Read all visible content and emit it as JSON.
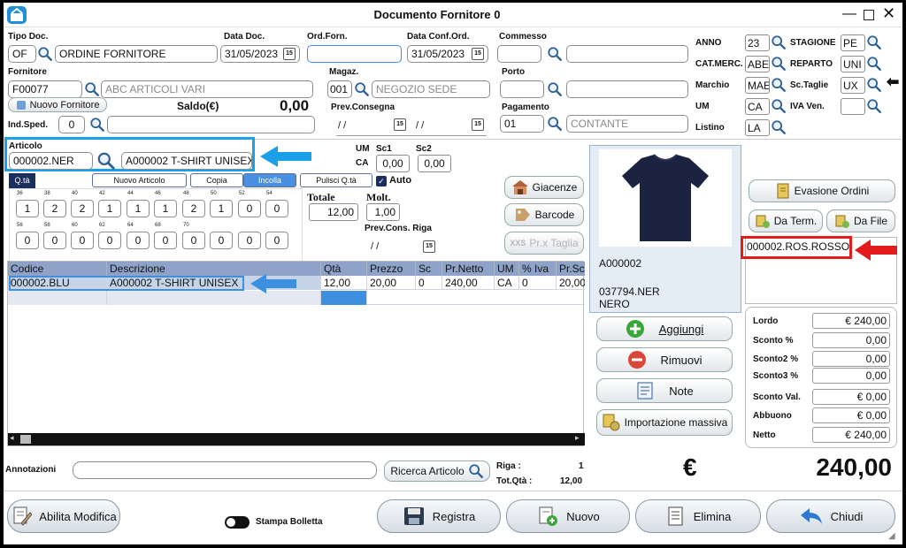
{
  "window": {
    "title": "Documento Fornitore 0"
  },
  "header": {
    "tipo_doc": {
      "label": "Tipo Doc.",
      "code": "OF",
      "desc": "ORDINE FORNITORE"
    },
    "data_doc": {
      "label": "Data Doc.",
      "value": "31/05/2023"
    },
    "ord_forn": {
      "label": "Ord.Forn.",
      "value": ""
    },
    "data_conf": {
      "label": "Data Conf.Ord.",
      "value": "31/05/2023"
    },
    "commesso": {
      "label": "Commesso",
      "code": "",
      "desc": ""
    },
    "fornitore": {
      "label": "Fornitore",
      "code": "F00077",
      "desc": "ABC ARTICOLI VARI"
    },
    "magaz": {
      "label": "Magaz.",
      "code": "001",
      "desc": "NEGOZIO SEDE"
    },
    "porto": {
      "label": "Porto",
      "code": "",
      "desc": ""
    },
    "nuovo_fornitore": "Nuovo Fornitore",
    "saldo": {
      "label": "Saldo(€)",
      "value": "0,00"
    },
    "prev_consegna": {
      "label": "Prev.Consegna",
      "value1": "/ /",
      "value2": "/ /"
    },
    "pagamento": {
      "label": "Pagamento",
      "code": "01",
      "desc": "CONTANTE"
    },
    "ind_sped": {
      "label": "Ind.Sped.",
      "code": "0",
      "desc": ""
    }
  },
  "side": {
    "anno": {
      "label": "ANNO",
      "value": "23"
    },
    "cat_merc": {
      "label": "CAT.MERC.",
      "value": "ABE"
    },
    "marchio": {
      "label": "Marchio",
      "value": "MAE"
    },
    "um": {
      "label": "UM",
      "value": "CA"
    },
    "listino": {
      "label": "Listino",
      "value": "LA"
    },
    "stagione": {
      "label": "STAGIONE",
      "value": "PE"
    },
    "reparto": {
      "label": "REPARTO",
      "value": "UNI"
    },
    "sc_taglie": {
      "label": "Sc.Taglie",
      "value": "UX"
    },
    "iva_ven": {
      "label": "IVA Ven.",
      "value": ""
    }
  },
  "articolo": {
    "label": "Articolo",
    "code": "000002.NER",
    "desc": "A000002 T-SHIRT UNISEX",
    "um_label": "UM",
    "um_value": "CA",
    "sc1_label": "Sc1",
    "sc1_value": "0,00",
    "sc2_label": "Sc2",
    "sc2_value": "0,00"
  },
  "toolbar": {
    "qta_tab": "Q.tà",
    "nuovo_articolo": "Nuovo Articolo",
    "copia": "Copia",
    "incolla": "Incolla",
    "pulisci": "Pulisci Q.tà",
    "auto": "Auto"
  },
  "sizes": {
    "row1_labels": [
      "36",
      "38",
      "40",
      "42",
      "44",
      "46",
      "48",
      "50",
      "52",
      "54"
    ],
    "row1_values": [
      "1",
      "2",
      "2",
      "1",
      "1",
      "1",
      "2",
      "1",
      "0",
      "0"
    ],
    "row2_labels": [
      "56",
      "58",
      "60",
      "62",
      "64",
      "68",
      "70",
      "",
      "",
      ""
    ],
    "row2_values": [
      "0",
      "0",
      "0",
      "0",
      "0",
      "0",
      "0",
      "0",
      "0",
      "0"
    ]
  },
  "totals_mid": {
    "totale_label": "Totale",
    "totale_value": "12,00",
    "molt_label": "Molt.",
    "molt_value": "1,00",
    "prev_cons_label": "Prev.Cons. Riga",
    "prev_cons_value": "/ /"
  },
  "mid_buttons": {
    "giacenze": "Giacenze",
    "barcode": "Barcode",
    "prx_taglia": "Pr.x Taglia"
  },
  "table": {
    "columns": [
      "Codice",
      "Descrizione",
      "Qtà",
      "Prezzo",
      "Sc",
      "Pr.Netto",
      "UM",
      "% Iva",
      "Pr.Sc"
    ],
    "rows": [
      [
        "000002.BLU",
        "A000002 T-SHIRT UNISEX",
        "12,00",
        "20,00",
        "0",
        "240,00",
        "CA",
        "0",
        "20,00"
      ]
    ]
  },
  "footer_info": {
    "annotazioni_label": "Annotazioni",
    "annotazioni_value": "",
    "ricerca": "Ricerca Articolo",
    "riga_label": "Riga :",
    "riga_value": "1",
    "totqta_label": "Tot.Qtà :",
    "totqta_value": "12,00"
  },
  "image_panel": {
    "article_code": "A000002",
    "barcode": "037794.NER",
    "color": "NERO"
  },
  "right_buttons": {
    "evasione": "Evasione Ordini",
    "da_term": "Da Term.",
    "da_file": "Da File"
  },
  "right_list": {
    "item": "000002.ROS.ROSSO"
  },
  "actions": {
    "aggiungi": "Aggiungi",
    "rimuovi": "Rimuovi",
    "note": "Note",
    "importazione": "Importazione massiva"
  },
  "totals": {
    "lordo": {
      "label": "Lordo",
      "value": "€ 240,00"
    },
    "sconto": {
      "label": "Sconto %",
      "value": "0,00"
    },
    "sconto2": {
      "label": "Sconto2 %",
      "value": "0,00"
    },
    "sconto3": {
      "label": "Sconto3 %",
      "value": "0,00"
    },
    "sconto_val": {
      "label": "Sconto Val.",
      "value": "€ 0,00"
    },
    "abbuono": {
      "label": "Abbuono",
      "value": "€ 0,00"
    },
    "netto": {
      "label": "Netto",
      "value": "€ 240,00"
    }
  },
  "grand_total": {
    "currency": "€",
    "value": "240,00"
  },
  "bottom": {
    "abilita": "Abilita Modifica",
    "stampa": "Stampa Bolletta",
    "registra": "Registra",
    "nuovo": "Nuovo",
    "elimina": "Elimina",
    "chiudi": "Chiudi"
  },
  "colors": {
    "accent": "#3d8fe0",
    "highlight_box": "#1aa0e8",
    "red_box": "#e31b1b",
    "table_header": "#8fa3c9",
    "image_bg": "#e4ecf5"
  }
}
